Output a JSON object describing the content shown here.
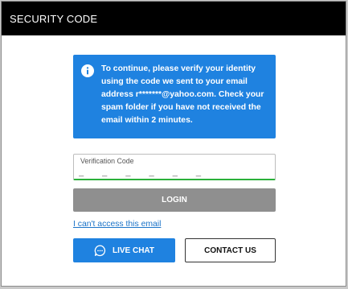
{
  "header": {
    "title": "SECURITY CODE"
  },
  "notice": {
    "icon": "info-icon",
    "text": "To continue, please verify your identity using the code we sent to your email address r*******@yahoo.com. Check your spam folder if you have not received the email within 2 minutes."
  },
  "verification": {
    "label": "Verification Code",
    "placeholder": "_ _ _ _ _ _"
  },
  "buttons": {
    "login": "LOGIN",
    "live_chat": "LIVE CHAT",
    "contact_us": "CONTACT US"
  },
  "links": {
    "cant_access": "I can't access this email"
  },
  "colors": {
    "header_bg": "#000000",
    "accent_blue": "#1f82e0",
    "login_disabled": "#8f8f8f",
    "input_focus": "#2bb03a",
    "link": "#1a73c8"
  },
  "icons": {
    "chat": "chat-bubble-icon"
  }
}
